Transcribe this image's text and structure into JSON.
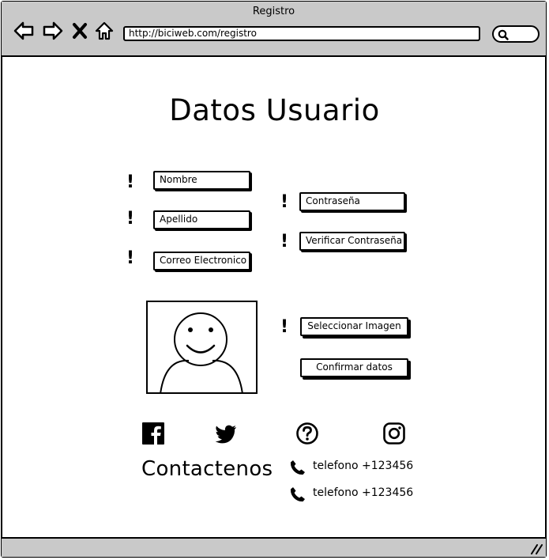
{
  "window": {
    "title": "Registro",
    "url": "http://biciweb.com/registro"
  },
  "page": {
    "title": "Datos Usuario"
  },
  "form": {
    "fields_left": [
      "Nombre",
      "Apellido",
      "Correo Electronico"
    ],
    "fields_right": [
      "Contraseña",
      "Verificar Contraseña"
    ],
    "required_mark": "!"
  },
  "image_section": {
    "select_label": "Seleccionar Imagen",
    "confirm_label": "Confirmar datos"
  },
  "social": {
    "icons": [
      "facebook-icon",
      "twitter-icon",
      "help-icon",
      "instagram-icon"
    ]
  },
  "contact": {
    "title": "Contactenos",
    "phones": [
      "telefono +123456",
      "telefono +123456"
    ]
  }
}
